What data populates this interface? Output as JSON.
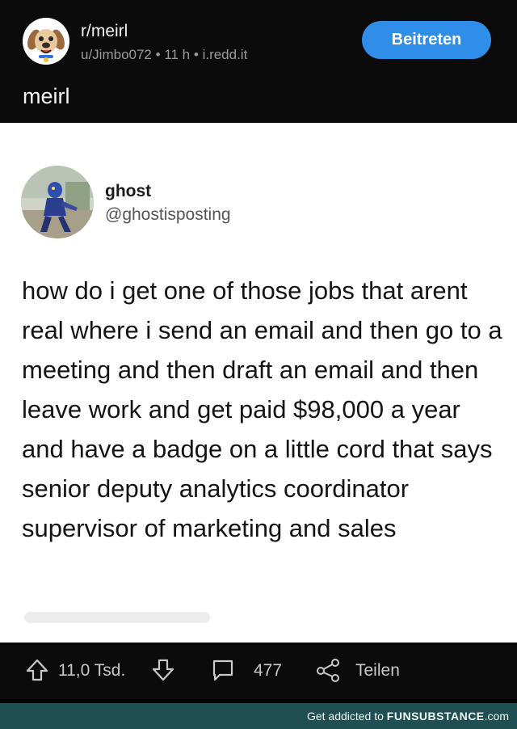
{
  "header": {
    "subreddit": "r/meirl",
    "author": "u/Jimbo072",
    "age": "11 h",
    "domain": "i.redd.it",
    "join_label": "Beitreten",
    "post_title": "meirl"
  },
  "tweet": {
    "display_name": "ghost",
    "handle": "@ghostisposting",
    "text": "how do i get one of those jobs that arent real where i send an email and then go to a meeting and then draft an email and then leave work and get paid $98,000 a year and have a badge on a little cord that says senior deputy analytics coordinator supervisor of marketing and sales"
  },
  "actions": {
    "votes": "11,0 Tsd.",
    "comments": "477",
    "share_label": "Teilen"
  },
  "footer": {
    "prefix": "Get addicted to ",
    "brand": "FUNSUBSTANCE",
    "suffix": ".com"
  },
  "colors": {
    "join_button": "#2e8ee8",
    "footer_bar": "#1f4f52",
    "background": "#0b0b0b"
  },
  "icons": [
    "dog-mascot-icon",
    "upvote-icon",
    "downvote-icon",
    "comment-icon",
    "share-icon"
  ]
}
